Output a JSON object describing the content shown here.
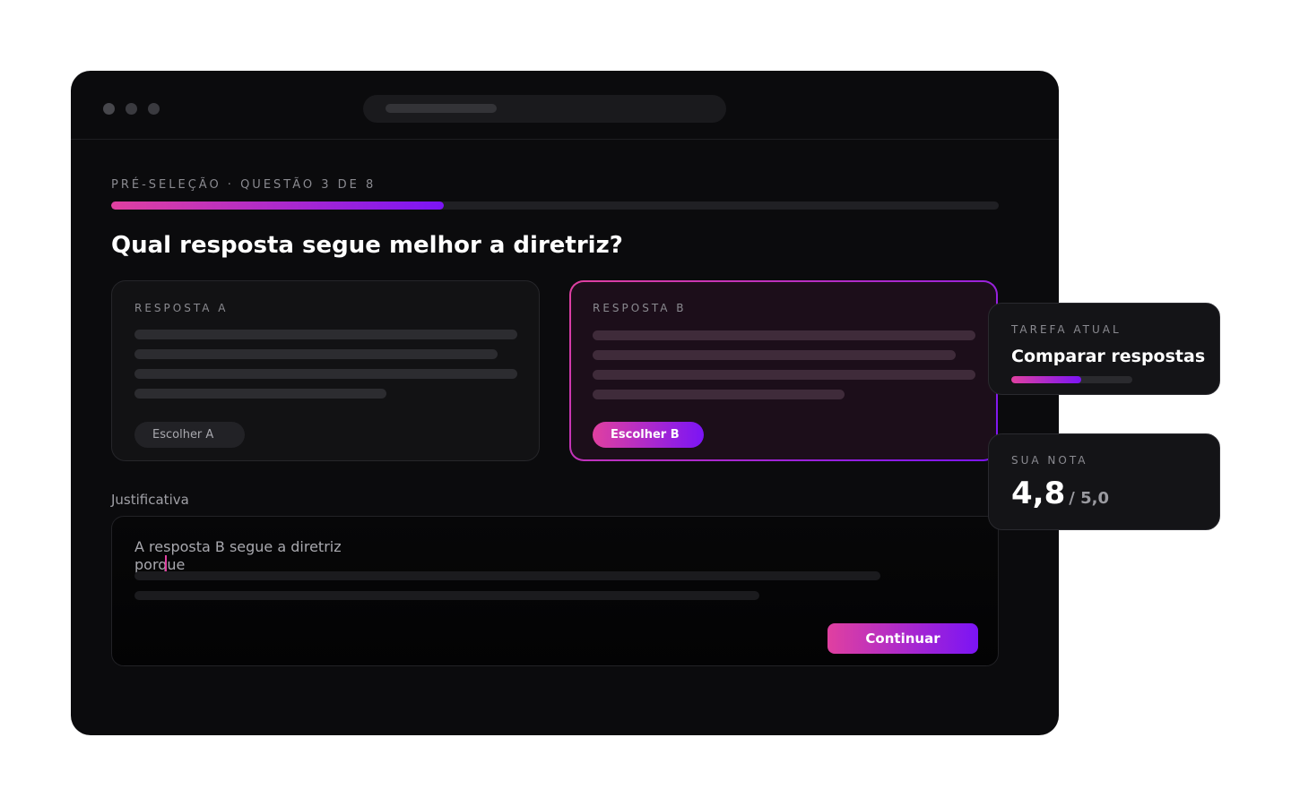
{
  "header": {
    "eyebrow": "PRÉ-SELEÇÃO · QUESTÃO 3 DE 8",
    "progress_fraction": 0.375
  },
  "question": "Qual resposta segue melhor a diretriz?",
  "options": [
    {
      "label": "RESPOSTA A",
      "button": "Escolher A",
      "selected": false
    },
    {
      "label": "RESPOSTA B",
      "button": "Escolher B",
      "selected": true
    }
  ],
  "justification": {
    "label": "Justificativa",
    "value": "A resposta B segue a diretriz porque"
  },
  "continue_label": "Continuar",
  "task_card": {
    "label": "TAREFA ATUAL",
    "title": "Comparar respostas",
    "progress_fraction": 0.58
  },
  "grade_card": {
    "label": "SUA NOTA",
    "value": "4,8",
    "max": "/ 5,0"
  },
  "colors": {
    "accent_start": "#e040a0",
    "accent_end": "#7b14f5",
    "background": "#0b0b0d"
  }
}
